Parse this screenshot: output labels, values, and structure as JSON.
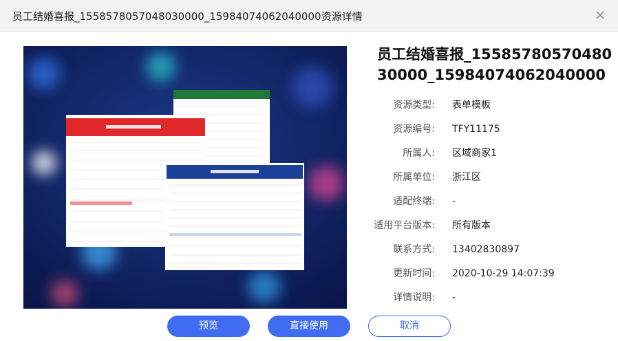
{
  "dialog": {
    "title": "员工结婚喜报_1558578057048030000_15984074062040000资源详情",
    "close_icon": "close-icon"
  },
  "preview": {
    "image_alt": "form-template-preview",
    "colors": {
      "bg_dark": "#0b1a55",
      "red": "#e0282a",
      "green": "#1f7a3a",
      "blue": "#1c3f98"
    }
  },
  "info": {
    "title": "员工结婚喜报_1558578057048030000_15984074062040000",
    "fields": [
      {
        "label": "资源类型:",
        "value": "表单模板"
      },
      {
        "label": "资源编号:",
        "value": "TFY11175"
      },
      {
        "label": "所属人:",
        "value": "区域商家1"
      },
      {
        "label": "所属单位:",
        "value": "浙江区"
      },
      {
        "label": "适配终端:",
        "value": "-"
      },
      {
        "label": "适用平台版本:",
        "value": "所有版本"
      },
      {
        "label": "联系方式:",
        "value": "13402830897"
      },
      {
        "label": "更新时间:",
        "value": "2020-10-29 14:07:39"
      },
      {
        "label": "详情说明:",
        "value": "-"
      }
    ]
  },
  "buttons": {
    "preview_label": "预览",
    "use_label": "直接使用",
    "cancel_label": "取消"
  },
  "colors": {
    "primary": "#3f6cf0",
    "header_bg": "#f2f2f2"
  }
}
